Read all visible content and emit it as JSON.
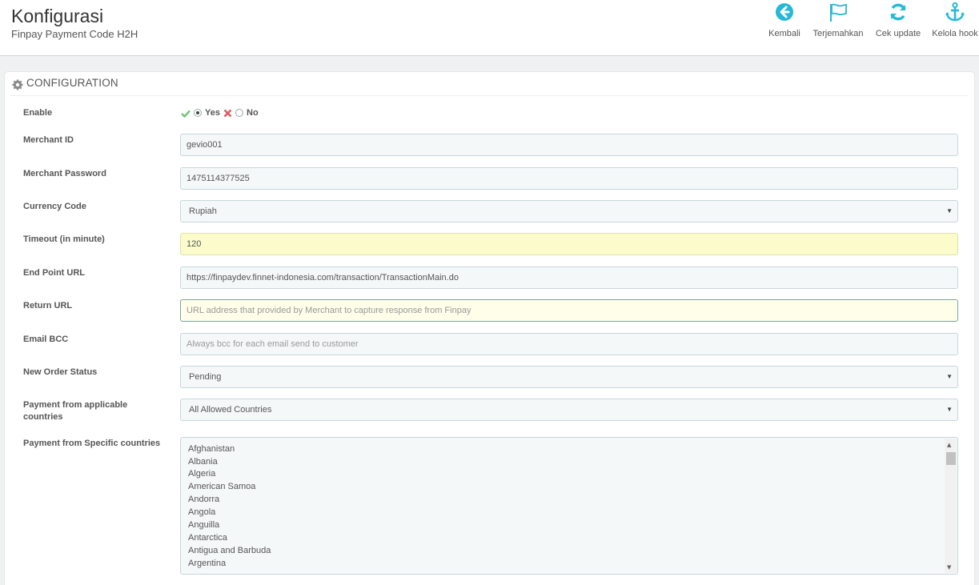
{
  "header": {
    "title": "Konfigurasi",
    "subtitle": "Finpay Payment Code H2H",
    "toolbar": [
      {
        "label": "Kembali",
        "icon": "arrow-left-circle-icon"
      },
      {
        "label": "Terjemahkan",
        "icon": "flag-icon"
      },
      {
        "label": "Cek update",
        "icon": "refresh-icon"
      },
      {
        "label": "Kelola hook",
        "icon": "anchor-icon"
      }
    ]
  },
  "panel": {
    "heading": "CONFIGURATION",
    "icon": "gear-icon"
  },
  "form": {
    "enable": {
      "label": "Enable",
      "yes": "Yes",
      "no": "No",
      "selected": "Yes"
    },
    "merchant_id": {
      "label": "Merchant ID",
      "value": "gevio001"
    },
    "merchant_password": {
      "label": "Merchant Password",
      "value": "1475114377525"
    },
    "currency_code": {
      "label": "Currency Code",
      "value": "Rupiah"
    },
    "timeout": {
      "label": "Timeout (in minute)",
      "value": "120"
    },
    "end_point_url": {
      "label": "End Point URL",
      "value": "https://finpaydev.finnet-indonesia.com/transaction/TransactionMain.do"
    },
    "return_url": {
      "label": "Return URL",
      "value": "",
      "placeholder": "URL address that provided by Merchant to capture response from Finpay"
    },
    "email_bcc": {
      "label": "Email BCC",
      "value": "",
      "placeholder": "Always bcc for each email send to customer"
    },
    "new_order_status": {
      "label": "New Order Status",
      "value": "Pending"
    },
    "applicable_countries": {
      "label": "Payment from applicable countries",
      "value": "All Allowed Countries"
    },
    "specific_countries": {
      "label": "Payment from Specific countries",
      "options": [
        "Afghanistan",
        "Albania",
        "Algeria",
        "American Samoa",
        "Andorra",
        "Angola",
        "Anguilla",
        "Antarctica",
        "Antigua and Barbuda",
        "Argentina"
      ]
    }
  },
  "colors": {
    "accent": "#25b9d7",
    "check_green": "#72c279",
    "cross_red": "#e08f95",
    "highlight_field": "#fbfbcc"
  }
}
